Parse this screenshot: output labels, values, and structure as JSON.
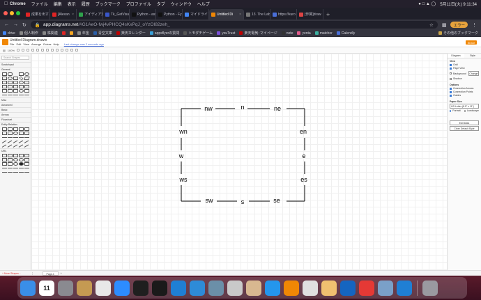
{
  "menubar": {
    "app_name": "Chrome",
    "items": [
      "ファイル",
      "編集",
      "表示",
      "履歴",
      "ブックマーク",
      "プロファイル",
      "タブ",
      "ウィンドウ",
      "ヘルプ"
    ],
    "clock": "5月11日(火) 9:11:34"
  },
  "tabs": [
    {
      "label": "成果を出す人",
      "color": "#e02424"
    },
    {
      "label": "[Alexan",
      "color": "#e02424"
    },
    {
      "label": "アイディア別",
      "color": "#2fa24c"
    },
    {
      "label": "Tk_GetVisu",
      "color": "#3956c9"
    },
    {
      "label": "Python - ass",
      "color": "#111111"
    },
    {
      "label": "Python - Fy",
      "color": "#111111"
    },
    {
      "label": "マイドライブ",
      "color": "#4285f4"
    },
    {
      "label": "Untitled Di",
      "color": "#f08705",
      "active": true
    },
    {
      "label": "13. The Lab",
      "color": "#777777"
    },
    {
      "label": "https://kuro",
      "color": "#4a6fd8"
    },
    {
      "label": "[作図]draw",
      "color": "#d44"
    }
  ],
  "toolbar": {
    "url_host": "app.diagrams.net",
    "url_path": "/#G1AeO-fwj4vPHCQ4sKxPqJ_oYzOI82zeh_",
    "error_label": "エラー"
  },
  "bookmarks": {
    "items": [
      {
        "label": "drive",
        "color": "#4285f4"
      },
      {
        "label": "個人制作",
        "color": "#888"
      },
      {
        "label": "株関連",
        "color": "#888"
      },
      {
        "label": "",
        "color": "#e02424"
      },
      {
        "label": "",
        "color": "#f5a623"
      },
      {
        "label": "年金",
        "color": "#888"
      },
      {
        "label": "青空文庫",
        "color": "#2b5fa8"
      },
      {
        "label": "楽天カレンダー",
        "color": "#bf0000"
      },
      {
        "label": "appsflyerの質問",
        "color": "#3aa0d8"
      },
      {
        "label": "トモダチゲーム",
        "color": "#555"
      },
      {
        "label": "youTrust",
        "color": "#7a4fd8"
      },
      {
        "label": "楽天電気･マイページ",
        "color": "#bf0000"
      },
      {
        "label": "note",
        "color": "#333"
      },
      {
        "label": "yenta",
        "color": "#e05a8a"
      },
      {
        "label": "matcher",
        "color": "#3bb0a0"
      },
      {
        "label": "Calendly",
        "color": "#4a6fd8"
      }
    ],
    "other_label": "その他のブックマーク"
  },
  "drawio": {
    "doc_title": "Untitled Diagram.drawio",
    "menus": [
      "File",
      "Edit",
      "View",
      "Arrange",
      "Extras",
      "Help"
    ],
    "save_note": "Last change was 2 seconds ago",
    "share_label": "Share",
    "zoom": "100%",
    "search_placeholder": "Search Shapes",
    "categories": {
      "scratchpad": "Scratchpad",
      "general": "General",
      "misc": "Misc",
      "advanced": "Advanced",
      "basic": "Basic",
      "arrows": "Arrows",
      "flowchart": "Flowchart",
      "entity_relation": "Entity Relation",
      "uml": "UML"
    },
    "more_shapes": "+ More Shapes...",
    "page_tab": "Page-1",
    "format_panel": {
      "tab_diagram": "Diagram",
      "tab_style": "Style",
      "view_title": "View",
      "grid": "Grid",
      "page_view": "Page View",
      "background": "Background",
      "change": "Change",
      "shadow": "Shadow",
      "options_title": "Options",
      "connection_arrows": "Connection Arrows",
      "connection_points": "Connection Points",
      "guides": "Guides",
      "paper_size_title": "Paper Size",
      "paper_size_value": "US-Letter (8.5\" x 11\")",
      "portrait": "Portrait",
      "landscape": "Landscape",
      "edit_data": "Edit Data",
      "clear_default_style": "Clear Default Style"
    },
    "diagram_labels": {
      "nw": "nw",
      "n": "n",
      "ne": "ne",
      "wn": "wn",
      "en": "en",
      "w": "w",
      "e": "e",
      "ws": "ws",
      "es": "es",
      "sw": "sw",
      "s": "s",
      "se": "se"
    }
  },
  "dock": {
    "calendar_day": "11",
    "icons": [
      {
        "name": "finder-icon",
        "color": "#3a8ee8"
      },
      {
        "name": "calendar-icon",
        "color": "#ffffff"
      },
      {
        "name": "system-preferences-icon",
        "color": "#8a8a90"
      },
      {
        "name": "archive-icon",
        "color": "#c59a52"
      },
      {
        "name": "chrome-icon",
        "color": "#e8e8e8"
      },
      {
        "name": "zoom-icon",
        "color": "#2d8cff"
      },
      {
        "name": "activity-monitor-icon",
        "color": "#1f1f1f"
      },
      {
        "name": "terminal-icon",
        "color": "#1a1a1a"
      },
      {
        "name": "vscode-icon",
        "color": "#1f7fd4"
      },
      {
        "name": "safari-icon",
        "color": "#2e8bd8"
      },
      {
        "name": "network-utility-icon",
        "color": "#6b8fa8"
      },
      {
        "name": "disk-utility-icon",
        "color": "#c9c9c9"
      },
      {
        "name": "script-editor-icon",
        "color": "#d8b890"
      },
      {
        "name": "docker-icon",
        "color": "#2496ed"
      },
      {
        "name": "drawio-icon",
        "color": "#f08705"
      },
      {
        "name": "keychain-icon",
        "color": "#e0e0e0"
      },
      {
        "name": "preview-icon",
        "color": "#f0c070"
      },
      {
        "name": "infinity-icon",
        "color": "#1565c0"
      },
      {
        "name": "clock-icon",
        "color": "#e53935"
      },
      {
        "name": "screenshot-icon",
        "color": "#7aa0c8"
      },
      {
        "name": "vscode-window-icon",
        "color": "#1f7fd4"
      },
      {
        "name": "trash-icon",
        "color": "#9a9aa0"
      }
    ]
  }
}
